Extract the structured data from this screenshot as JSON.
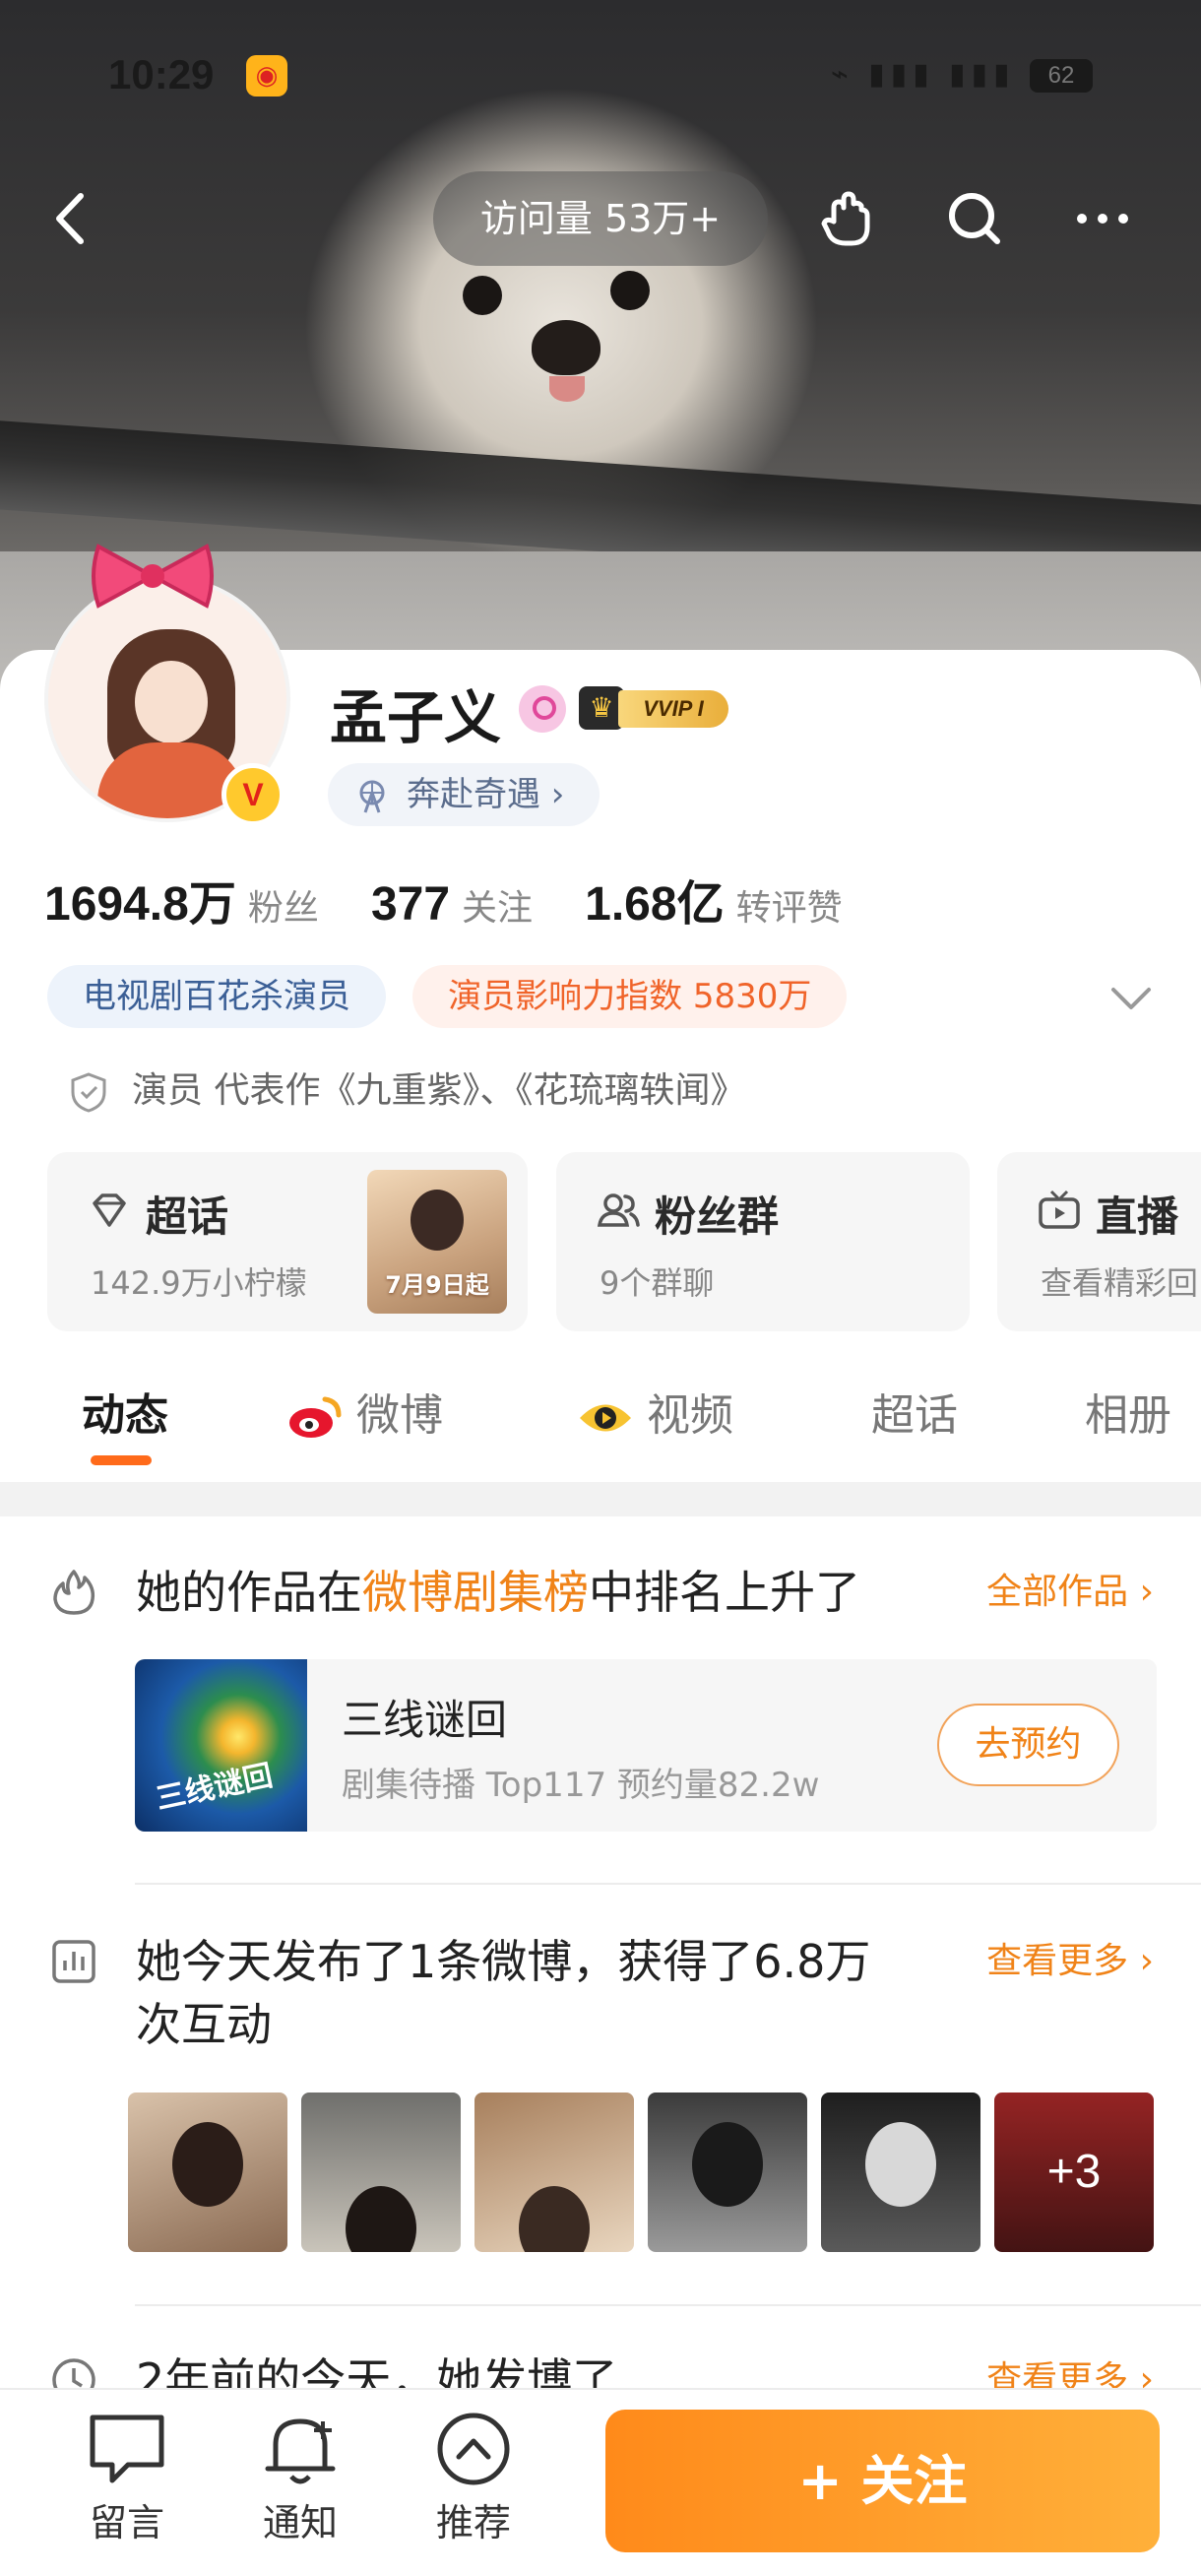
{
  "status_bar": {
    "time": "10:29",
    "weibo_icon": "weibo-app-icon",
    "battery": "62",
    "signal": "⌁ ▮▮▮ ▮▮▮"
  },
  "top_nav": {
    "visits": "访问量 53万+"
  },
  "profile": {
    "name": "孟子义",
    "vvip_label": "VVIP I",
    "hero_chip": "奔赴奇遇 ›",
    "verified_badge": "V",
    "stats": [
      {
        "num": "1694.8",
        "unit": "万",
        "label": "粉丝"
      },
      {
        "num": "377",
        "unit": "",
        "label": "关注"
      },
      {
        "num": "1.68",
        "unit": "亿",
        "label": "转评赞"
      }
    ],
    "tags": [
      "电视剧百花杀演员",
      "演员影响力指数 5830万"
    ],
    "bio": "演员 代表作《九重紫》、《花琉璃轶闻》"
  },
  "feature_cards": [
    {
      "title": "超话",
      "sub": "142.9万小柠檬",
      "poster_text": "7月9日起"
    },
    {
      "title": "粉丝群",
      "sub": "9个群聊"
    },
    {
      "title": "直播",
      "sub": "查看精彩回"
    }
  ],
  "tabs": [
    "动态",
    "微博",
    "视频",
    "超话",
    "相册"
  ],
  "feed": {
    "row1": {
      "title_pre": "她的作品在",
      "title_hl": "微博剧集榜",
      "title_post": "中排名上升了",
      "more": "全部作品 ›"
    },
    "drama": {
      "title": "三线谜回",
      "sub": "剧集待播 Top117 预约量82.2w",
      "button": "去预约",
      "thumb_text": "三线谜回"
    },
    "row2": {
      "title_line1": "她今天发布了1条微博，获得了6.8万",
      "title_line2": "次互动",
      "more": "查看更多 ›"
    },
    "thumbs_more": "+3",
    "row3": {
      "title": "2年前的今天，她发博了",
      "more": "查看更多 ›"
    }
  },
  "bottom_bar": {
    "items": [
      "留言",
      "通知",
      "推荐"
    ],
    "follow": "+ 关注"
  },
  "colors": {
    "accent": "#ff8a1a",
    "link": "#f08318",
    "tag_blue": "#3b5f96",
    "tag_orange": "#f0642a"
  }
}
